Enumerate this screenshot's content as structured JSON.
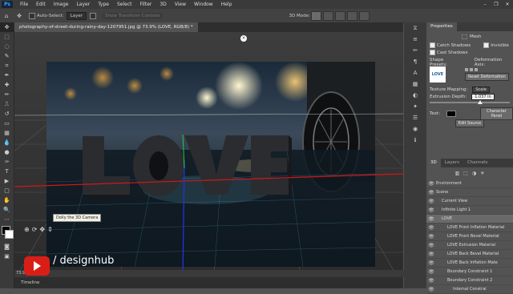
{
  "app": {
    "logo": "Ps"
  },
  "menu": [
    "File",
    "Edit",
    "Image",
    "Layer",
    "Type",
    "Select",
    "Filter",
    "3D",
    "View",
    "Window",
    "Help"
  ],
  "window_controls": [
    "–",
    "❐",
    "✕"
  ],
  "options": {
    "auto_select_label": "Auto-Select:",
    "auto_select_value": "Layer",
    "show_transform": "Show Transform Controls",
    "mode_label": "3D Mode:"
  },
  "document_tab": "photography-of-street-during-rainy-day-1207951.jpg @ 73.9% (LOVE, RGB/8) *",
  "status": "73.9%",
  "timeline_label": "Timeline",
  "tooltip": "Dolly the 3D Camera",
  "brand": "/ designhub",
  "properties": {
    "tab": "Properties",
    "mesh_label": "Mesh",
    "catch_shadows": "Catch Shadows",
    "invisible": "Invisible",
    "cast_shadows": "Cast Shadows",
    "shape_presets": "Shape Presets:",
    "deformation_axis": "Deformation Axis:",
    "reset_deformation": "Reset Deformation",
    "texture_mapping_label": "Texture Mapping:",
    "texture_mapping_value": "Scale",
    "extrusion_label": "Extrusion Depth:",
    "extrusion_value": "1.037 in",
    "text_label": "Text:",
    "character_panel": "Character Panel",
    "edit_source": "Edit Source",
    "preset_thumb": "LOVE"
  },
  "layers_panel": {
    "tabs": [
      "3D",
      "Layers",
      "Channels"
    ],
    "items": [
      {
        "label": "Environment",
        "indent": 0
      },
      {
        "label": "Scene",
        "indent": 0
      },
      {
        "label": "Current View",
        "indent": 1
      },
      {
        "label": "Infinite Light 1",
        "indent": 1
      },
      {
        "label": "LOVE",
        "indent": 1
      },
      {
        "label": "LOVE Front Inflation Material",
        "indent": 2
      },
      {
        "label": "LOVE Front Bevel Material",
        "indent": 2
      },
      {
        "label": "LOVE Extrusion Material",
        "indent": 2
      },
      {
        "label": "LOVE Back Bevel Material",
        "indent": 2
      },
      {
        "label": "LOVE Back Inflation Mate",
        "indent": 2
      },
      {
        "label": "Boundary Constraint 1",
        "indent": 2
      },
      {
        "label": "Boundary Constraint 2",
        "indent": 2
      },
      {
        "label": "Internal Constrai",
        "indent": 3
      }
    ]
  },
  "colors": {
    "accent": "#d91e18",
    "panel": "#535353",
    "dark": "#3a3a3a"
  }
}
